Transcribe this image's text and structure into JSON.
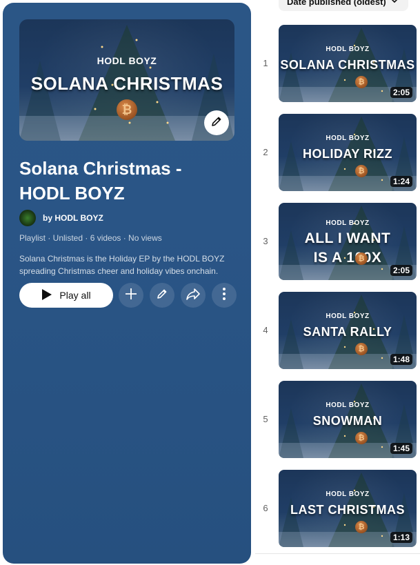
{
  "playlist": {
    "hero_subtitle": "HODL BOYZ",
    "hero_title": "SOLANA CHRISTMAS",
    "title": "Solana Christmas - HODL BOYZ",
    "owner": "by HODL BOYZ",
    "meta": "Playlist · Unlisted · 6 videos · No views",
    "description": "Solana Christmas is the Holiday EP by the HODL BOYZ spreading Christmas cheer and holiday vibes onchain.",
    "play_all_label": "Play all",
    "icons": {
      "edit_thumbnail": "pencil-icon",
      "play": "play-icon",
      "add": "plus-icon",
      "edit": "pencil-icon",
      "share": "share-icon",
      "more": "more-vert-icon"
    },
    "colors": {
      "panel": "#2a5586",
      "button": "#ffffff"
    }
  },
  "sort": {
    "label": "Date published (oldest)",
    "icon": "chevron-down-icon"
  },
  "videos": [
    {
      "index": "1",
      "band": "HODL BOYZ",
      "title_lines": [
        "SOLANA CHRISTMAS"
      ],
      "duration": "2:05"
    },
    {
      "index": "2",
      "band": "HODL BOYZ",
      "title_lines": [
        "HOLIDAY RIZZ"
      ],
      "duration": "1:24"
    },
    {
      "index": "3",
      "band": "HODL BOYZ",
      "title_lines": [
        "ALL I WANT",
        "IS A 100X"
      ],
      "duration": "2:05"
    },
    {
      "index": "4",
      "band": "HODL BOYZ",
      "title_lines": [
        "SANTA RALLY"
      ],
      "duration": "1:48"
    },
    {
      "index": "5",
      "band": "HODL BOYZ",
      "title_lines": [
        "SNOWMAN"
      ],
      "duration": "1:45"
    },
    {
      "index": "6",
      "band": "HODL BOYZ",
      "title_lines": [
        "LAST CHRISTMAS"
      ],
      "duration": "1:13"
    }
  ]
}
